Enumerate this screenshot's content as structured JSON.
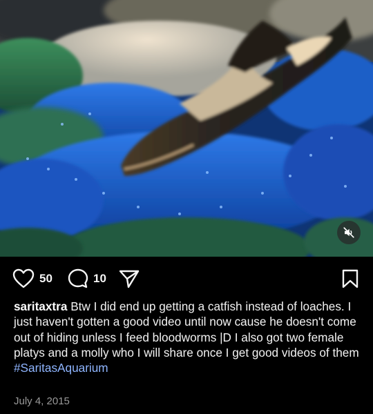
{
  "post": {
    "likes": "50",
    "comments": "10",
    "username": "saritaxtra",
    "caption": "Btw I did end up getting a catfish instead of loaches. I just haven't gotten a good video until now cause he doesn't come out of hiding unless I feed bloodworms |D I also got two female platys and a molly who I will share once I get good videos of them",
    "hashtag": "#SaritasAquarium",
    "date": "July 4, 2015"
  },
  "icons": {
    "like": "heart-icon",
    "comment": "speech-bubble-icon",
    "share": "paper-plane-icon",
    "save": "bookmark-icon",
    "mute": "speaker-muted-icon"
  },
  "colors": {
    "background": "#000000",
    "hashtag": "#8fb5ff",
    "date": "#9a9a9a"
  }
}
